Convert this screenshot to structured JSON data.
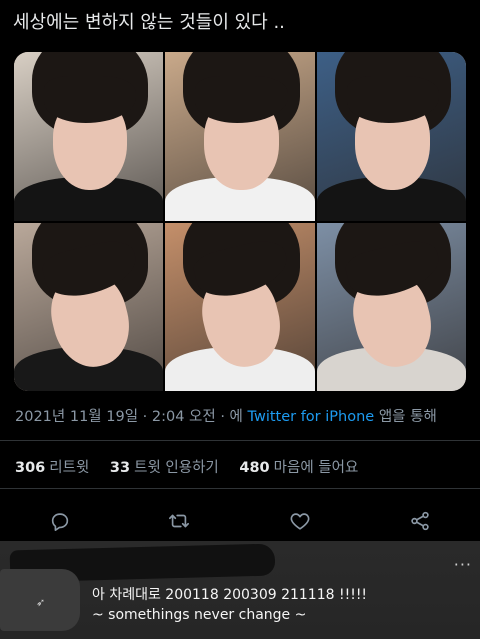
{
  "tweet": {
    "text": "세상에는 변하지 않는 것들이 있다 .."
  },
  "photos": [
    {
      "label": "photo-1",
      "bg": "#d8cfc4",
      "shirt": "#141414"
    },
    {
      "label": "photo-2",
      "bg": "#c9a98a",
      "shirt": "#f1f1f1"
    },
    {
      "label": "photo-3",
      "bg": "#3d5f86",
      "shirt": "#141414"
    },
    {
      "label": "photo-4",
      "bg": "#b9a89a",
      "shirt": "#181818"
    },
    {
      "label": "photo-5",
      "bg": "#c48f6a",
      "shirt": "#eeeeee"
    },
    {
      "label": "photo-6",
      "bg": "#7d8fa5",
      "shirt": "#d8d4cf"
    }
  ],
  "meta": {
    "datetime": "2021년 11월 19일 · 2:04 오전 · 에",
    "source": "Twitter for iPhone",
    "suffix": "앱을 통해"
  },
  "stats": {
    "retweets_count": "306",
    "retweets_label": "리트윗",
    "quotes_count": "33",
    "quotes_label": "트윗 인용하기",
    "likes_count": "480",
    "likes_label": "마음에 들어요"
  },
  "actions": {
    "reply_icon": "reply-icon",
    "retweet_icon": "retweet-icon",
    "like_icon": "heart-icon",
    "share_icon": "share-icon"
  },
  "comment": {
    "line1": "아 차례대로 200118 200309 211118 !!!!!",
    "line2": "~ somethings never change ~",
    "more": "···"
  },
  "colors": {
    "background": "#000000",
    "text": "#e7e9ea",
    "muted": "#8b98a5",
    "link": "#1d9bf0",
    "divider": "#2f3336"
  }
}
